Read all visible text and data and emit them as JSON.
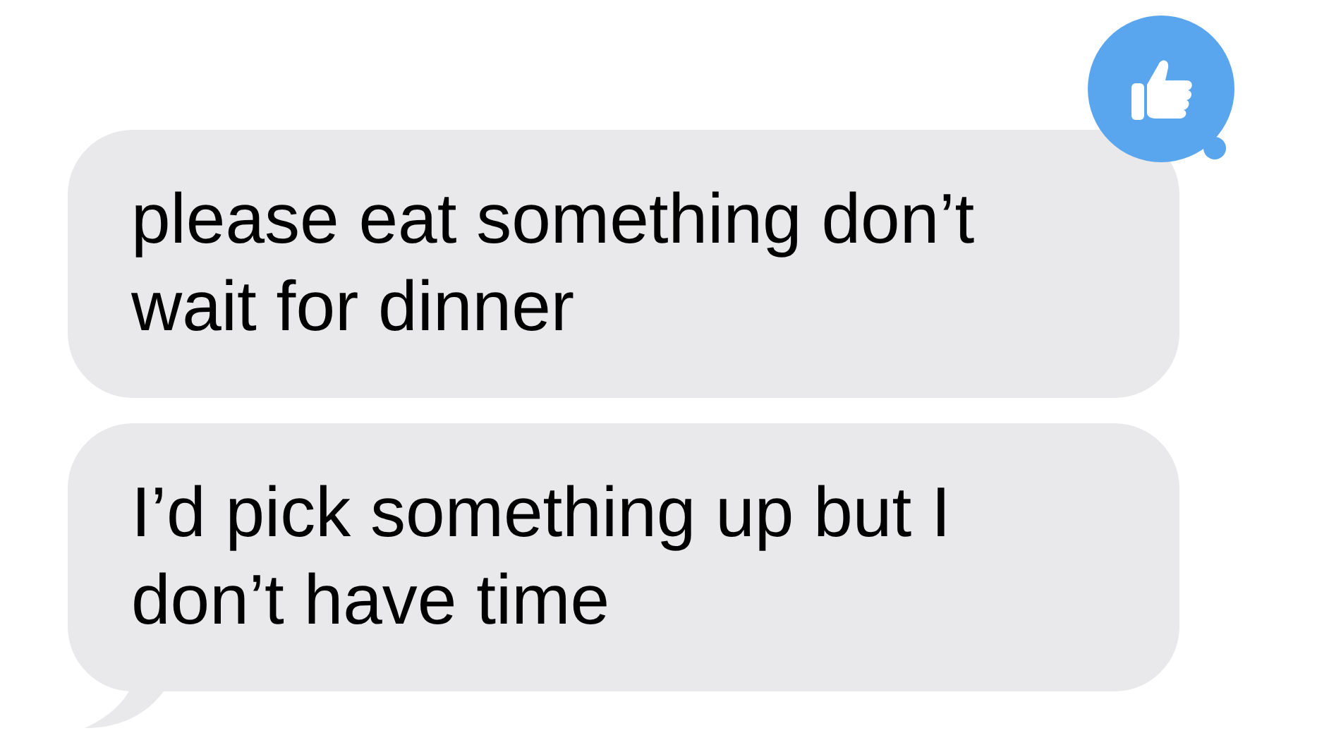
{
  "messages": [
    {
      "text": "please eat something don’t wait for dinner",
      "thumbs_up": true,
      "tail": false
    },
    {
      "text": "I’d pick something up but I don’t have time",
      "thumbs_up": false,
      "tail": true
    }
  ]
}
